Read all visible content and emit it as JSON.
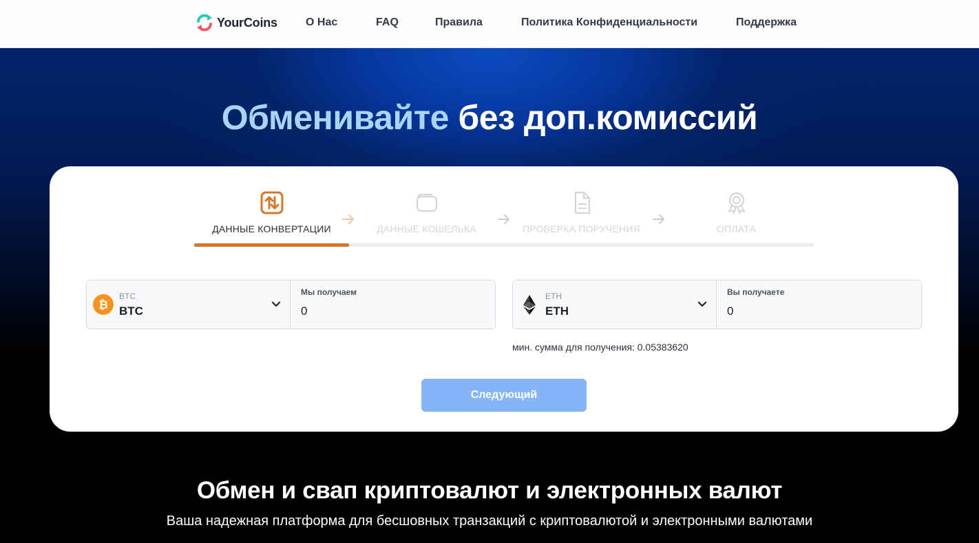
{
  "header": {
    "logo_text": "YourCoins",
    "nav": [
      {
        "label": "О Нас"
      },
      {
        "label": "FAQ"
      },
      {
        "label": "Правила"
      },
      {
        "label": "Политика Конфиденциальности"
      },
      {
        "label": "Поддержка"
      }
    ]
  },
  "hero": {
    "title_accent": "Обменивайте",
    "title_rest": "без доп.комиссий"
  },
  "steps": [
    {
      "label": "ДАННЫЕ КОНВЕРТАЦИИ",
      "icon": "exchange-arrows-icon",
      "active": true
    },
    {
      "label": "ДАННЫЕ КОШЕЛЬКА",
      "icon": "wallet-icon",
      "active": false
    },
    {
      "label": "ПРОВЕРКА ПОРУЧЕНИЯ",
      "icon": "document-icon",
      "active": false
    },
    {
      "label": "ОПЛАТА",
      "icon": "award-badge-icon",
      "active": false
    }
  ],
  "send": {
    "currency_code_small": "BTC",
    "currency_code": "BTC",
    "amount_label": "Мы получаем",
    "amount_value": "0",
    "icon": "bitcoin-icon",
    "icon_color": "#f7931a"
  },
  "receive": {
    "currency_code_small": "ETH",
    "currency_code": "ETH",
    "amount_label": "Вы получаете",
    "amount_value": "0",
    "icon": "ethereum-icon"
  },
  "min_note": "мин. сумма для получения: 0.05383620",
  "next_button": "Следующий",
  "section": {
    "title": "Обмен и свап криптовалют и электронных валют",
    "subtitle": "Ваша надежная платформа для бесшовных транзакций с криптовалютой и электронными валютами"
  },
  "colors": {
    "accent_orange": "#d5772b",
    "button_blue": "#83b5f7",
    "title_accent": "#a9d4f7"
  }
}
